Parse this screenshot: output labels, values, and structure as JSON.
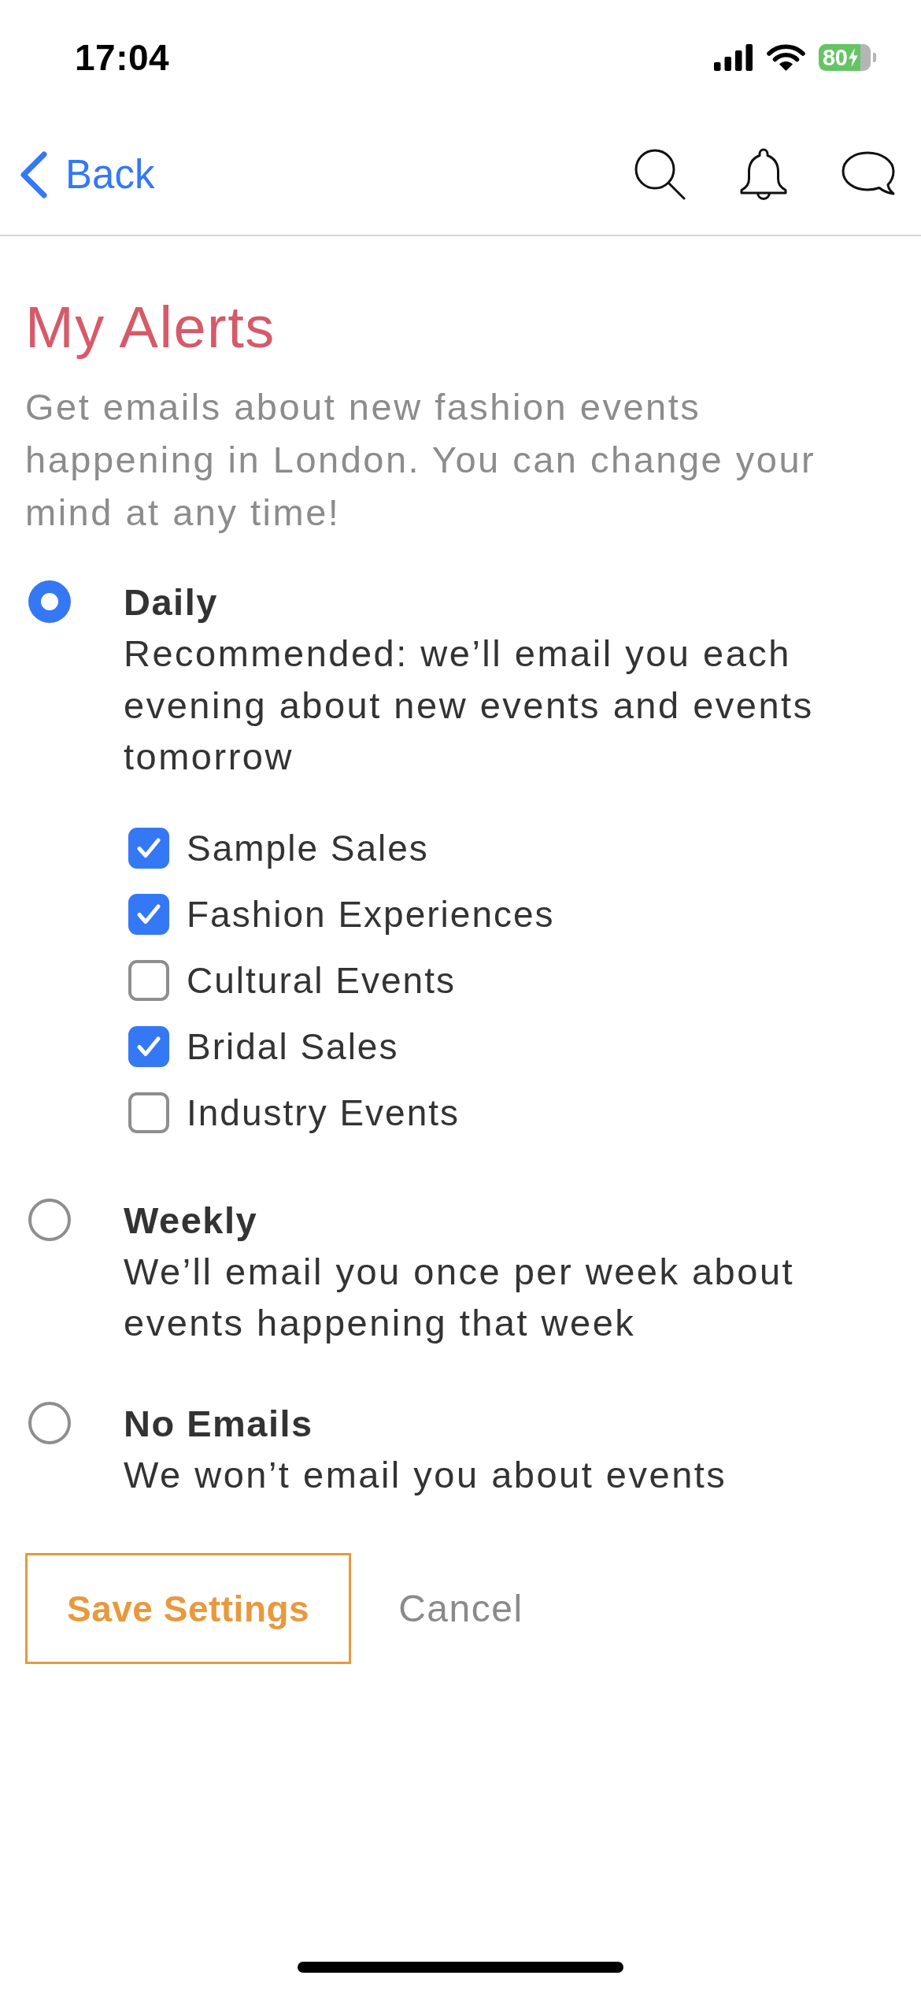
{
  "status_bar": {
    "time": "17:04",
    "battery": "80"
  },
  "nav": {
    "back": "Back"
  },
  "title": "My Alerts",
  "description": "Get emails about new fashion events happening in London. You can change your mind at any time!",
  "options": [
    {
      "label": "Daily",
      "description": "Recommended: we’ll email you each evening about new events and events tomorrow",
      "selected": true,
      "categories": [
        {
          "label": "Sample Sales",
          "checked": true
        },
        {
          "label": "Fashion Experiences",
          "checked": true
        },
        {
          "label": "Cultural Events",
          "checked": false
        },
        {
          "label": "Bridal Sales",
          "checked": true
        },
        {
          "label": "Industry Events",
          "checked": false
        }
      ]
    },
    {
      "label": "Weekly",
      "description": "We’ll email you once per week about events happening that week",
      "selected": false
    },
    {
      "label": "No Emails",
      "description": "We won’t email you about events",
      "selected": false
    }
  ],
  "buttons": [
    {
      "kind": "outlined",
      "label": "Save Settings"
    },
    {
      "kind": "text",
      "label": "Cancel"
    }
  ]
}
